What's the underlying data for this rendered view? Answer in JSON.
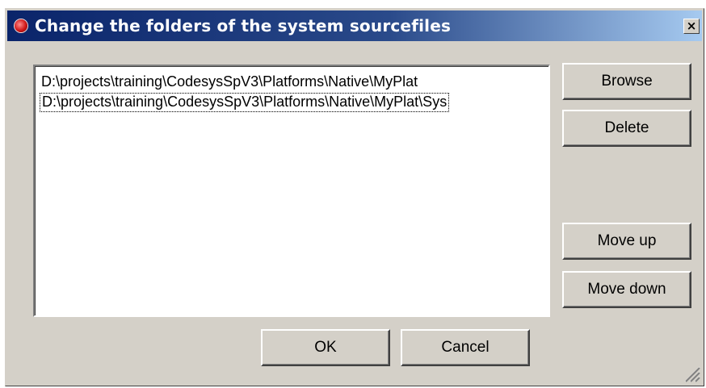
{
  "window": {
    "title": "Change the folders of the system sourcefiles",
    "close_label": "×"
  },
  "folders": {
    "items": [
      {
        "path": "D:\\projects\\training\\CodesysSpV3\\Platforms\\Native\\MyPlat",
        "focused": false
      },
      {
        "path": "D:\\projects\\training\\CodesysSpV3\\Platforms\\Native\\MyPlat\\Sys",
        "focused": true
      }
    ]
  },
  "buttons": {
    "browse": "Browse",
    "delete": "Delete",
    "move_up": "Move up",
    "move_down": "Move down",
    "ok": "OK",
    "cancel": "Cancel"
  },
  "icons": {
    "app": "app-icon",
    "close": "close-icon",
    "resize": "resize-grip-icon"
  },
  "colors": {
    "title_bar_start": "#0a246a",
    "title_bar_end": "#a6caf0",
    "dialog_face": "#d4d0c8",
    "app_icon": "#d01818"
  }
}
